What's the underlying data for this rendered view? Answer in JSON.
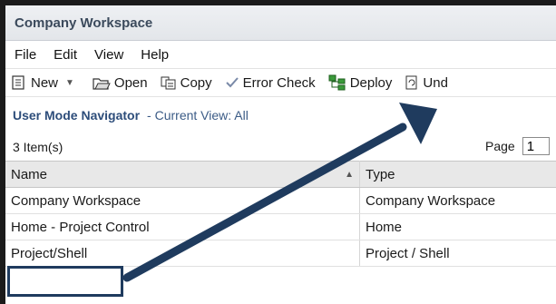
{
  "window": {
    "title": "Company Workspace"
  },
  "menu": [
    "File",
    "Edit",
    "View",
    "Help"
  ],
  "toolbar": {
    "new": "New",
    "open": "Open",
    "copy": "Copy",
    "error_check": "Error Check",
    "deploy": "Deploy",
    "undo": "Und"
  },
  "navigator": {
    "title": "User Mode Navigator",
    "view_label": "- Current View:  All"
  },
  "list": {
    "count": "3  Item(s)",
    "page_label": "Page",
    "page_value": "1"
  },
  "table": {
    "columns": [
      "Name",
      "Type"
    ],
    "rows": [
      {
        "name": "Company Workspace",
        "type": "Company Workspace"
      },
      {
        "name": "Home - Project Control",
        "type": "Home"
      },
      {
        "name": "Project/Shell",
        "type": "Project / Shell"
      }
    ]
  },
  "colors": {
    "accent": "#2d4d7a",
    "annotation": "#1f3b5e"
  }
}
